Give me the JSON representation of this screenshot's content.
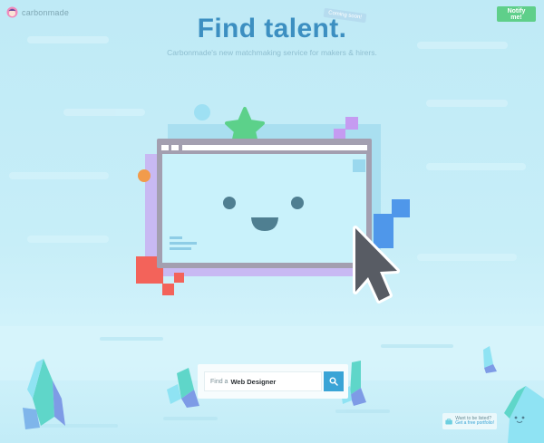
{
  "brand": {
    "name": "carbonmade"
  },
  "header": {
    "notify_label": "Notify me!"
  },
  "hero": {
    "title": "Find talent.",
    "badge": "Coming soon!",
    "subtitle": "Carbonmade's new matchmaking service for makers & hirers."
  },
  "search": {
    "prefix": "Find a",
    "value": "Web Designer"
  },
  "listed": {
    "line1": "Want to be listed?",
    "line2": "Get a free portfolio!"
  },
  "colors": {
    "accent": "#3c8fc1",
    "notify_green": "#5fcf8a",
    "search_blue": "#3aa4d6",
    "screen_frame": "#a39fb0",
    "star_green": "#5cd18a",
    "purple": "#c6b6f2",
    "red": "#f3635a",
    "blue_square": "#4f97ea",
    "orange": "#f29b4b"
  }
}
